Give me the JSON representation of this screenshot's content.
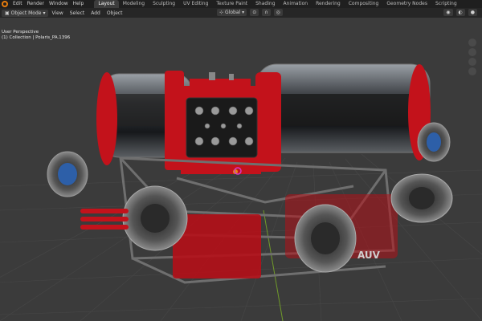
{
  "menu": [
    "Edit",
    "Render",
    "Window",
    "Help"
  ],
  "workspaces": [
    {
      "label": "Layout",
      "active": true
    },
    {
      "label": "Modeling"
    },
    {
      "label": "Sculpting"
    },
    {
      "label": "UV Editing"
    },
    {
      "label": "Texture Paint"
    },
    {
      "label": "Shading"
    },
    {
      "label": "Animation"
    },
    {
      "label": "Rendering"
    },
    {
      "label": "Compositing"
    },
    {
      "label": "Geometry Nodes"
    },
    {
      "label": "Scripting"
    }
  ],
  "toolbar": {
    "mode": "Object Mode",
    "menus": [
      "View",
      "Select",
      "Add",
      "Object"
    ],
    "transform_orientation": "Global"
  },
  "viewport": {
    "perspective": "User Perspective",
    "collection_line": "(1) Collection | Polaris_PA.1396",
    "logo_text": "AUV"
  },
  "colors": {
    "accent": "#4772b3",
    "red": "#c3121b",
    "grid": "#474747"
  }
}
